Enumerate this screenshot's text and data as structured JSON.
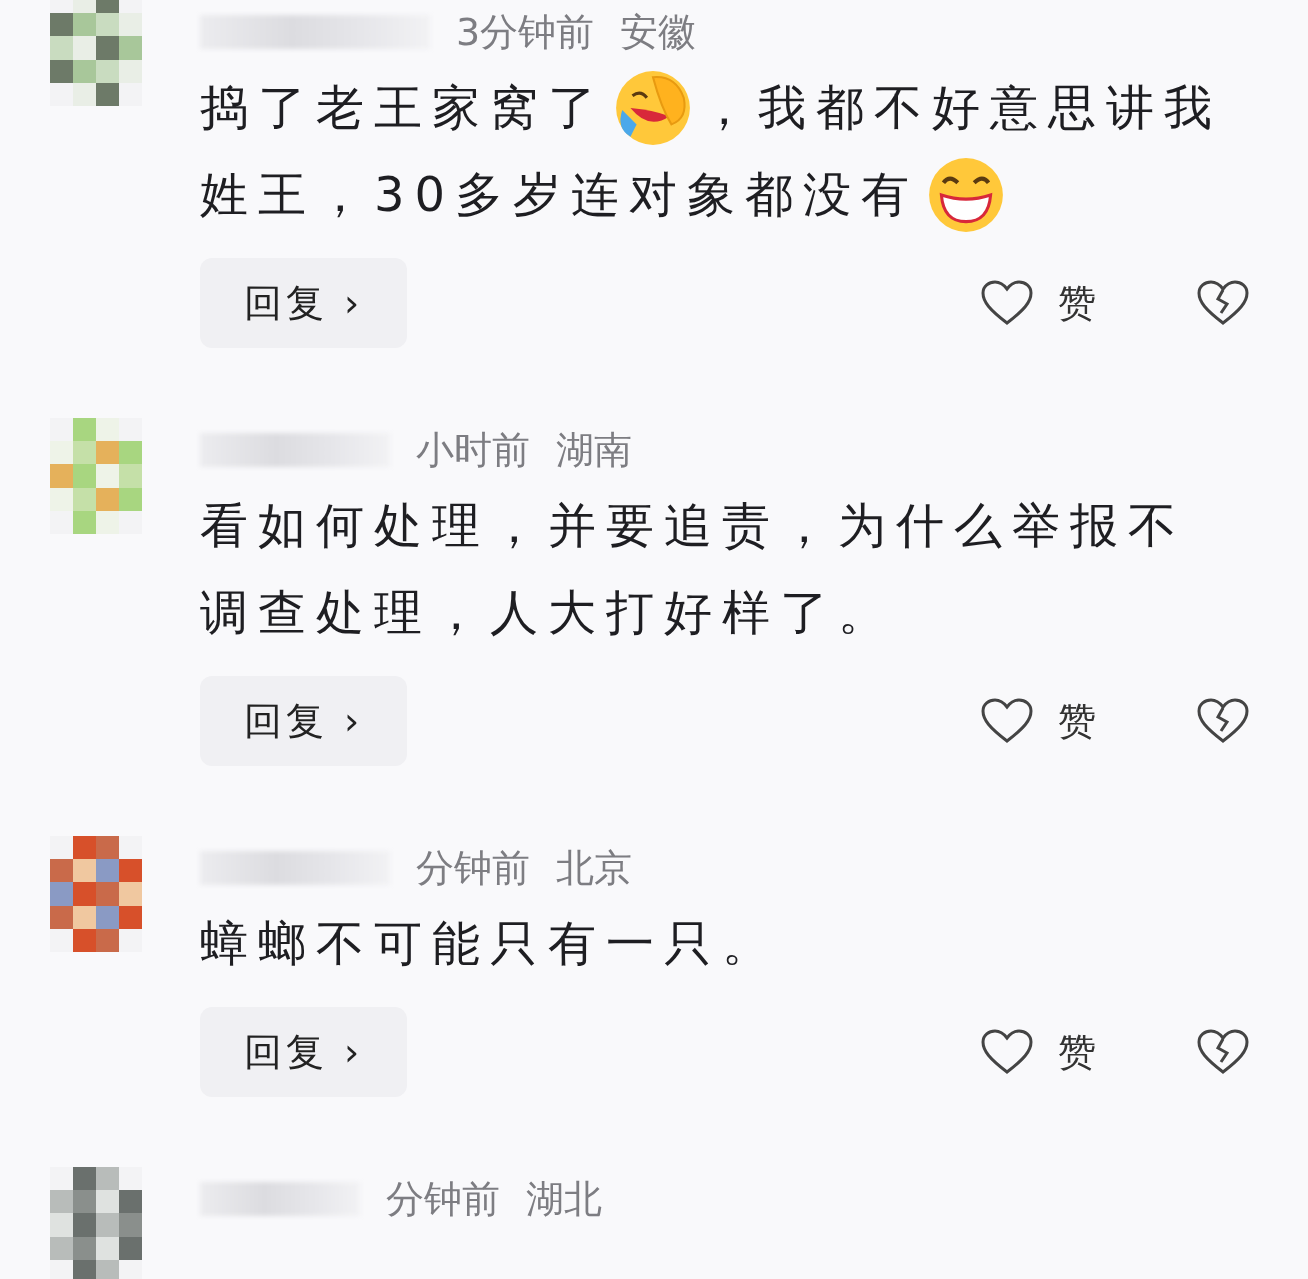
{
  "comments": [
    {
      "time": "3分钟前",
      "location": "安徽",
      "lines": [
        [
          {
            "kind": "text",
            "text": "捣了老王家窝了"
          },
          {
            "kind": "facepalm"
          },
          {
            "kind": "text",
            "text": "，我都不好意思讲我"
          }
        ],
        [
          {
            "kind": "text",
            "text": "姓王，30多岁连对象都没有"
          },
          {
            "kind": "grin"
          }
        ]
      ],
      "reply": "回复",
      "chevron": "›",
      "like": "赞"
    },
    {
      "time": "小时前",
      "location": "湖南",
      "lines": [
        [
          {
            "kind": "text",
            "text": "看如何处理，并要追责，为什么举报不"
          }
        ],
        [
          {
            "kind": "text",
            "text": "调查处理，人大打好样了。"
          }
        ]
      ],
      "reply": "回复",
      "chevron": "›",
      "like": "赞"
    },
    {
      "time": "分钟前",
      "location": "北京",
      "lines": [
        [
          {
            "kind": "text",
            "text": "蟑螂不可能只有一只。"
          }
        ]
      ],
      "reply": "回复",
      "chevron": "›",
      "like": "赞"
    },
    {
      "time": "分钟前",
      "location": "湖北"
    }
  ]
}
